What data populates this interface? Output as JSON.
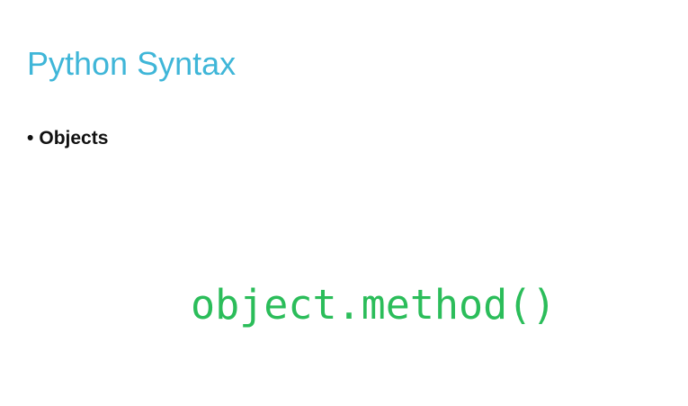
{
  "slide": {
    "title": "Python Syntax",
    "bullet_marker": "•",
    "bullet_text": "Objects",
    "code_example": "object.method()"
  }
}
